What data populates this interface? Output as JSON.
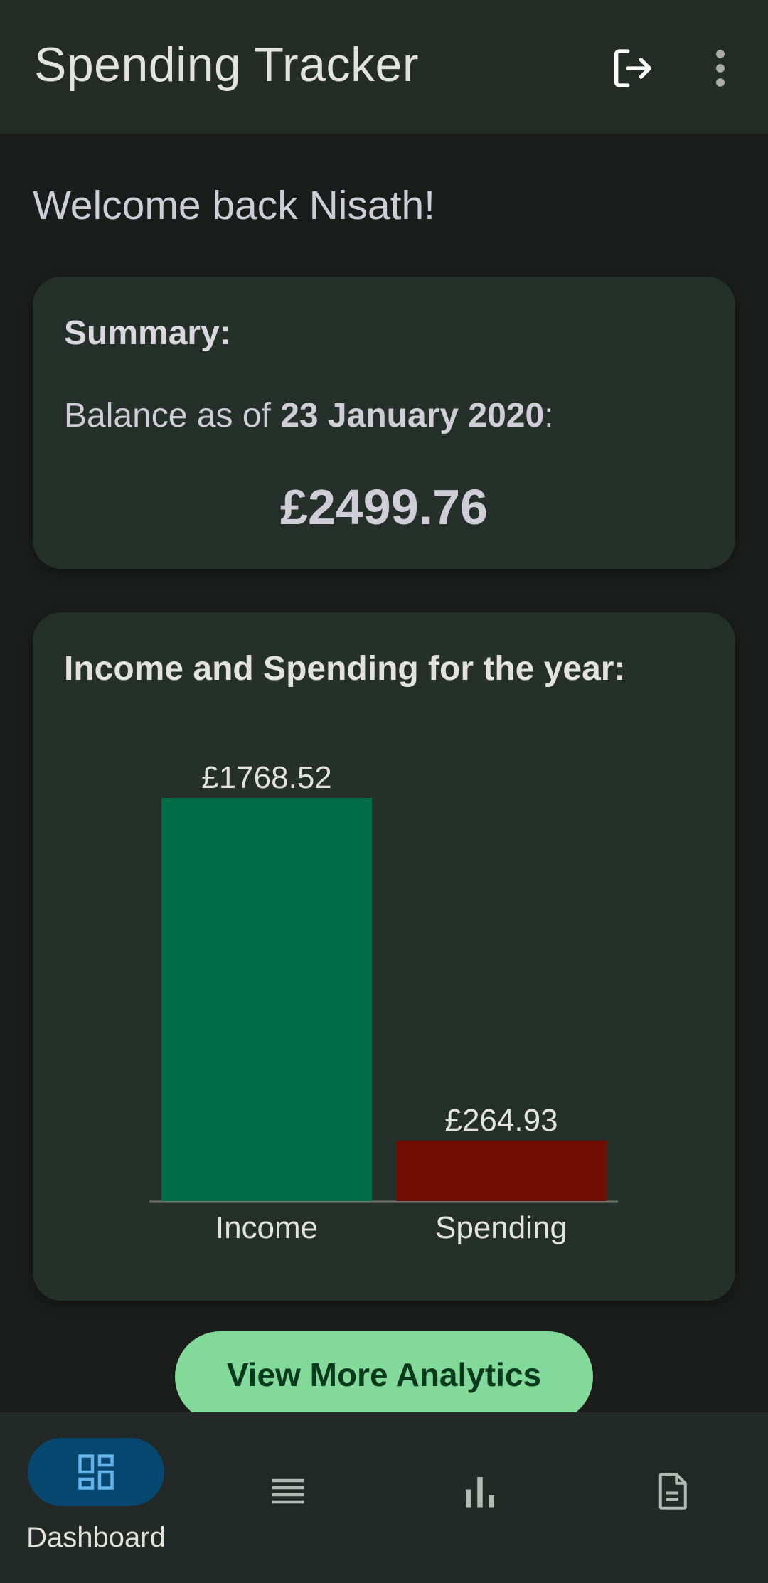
{
  "app_bar": {
    "title": "Spending Tracker",
    "logout_icon": "logout-icon",
    "more_icon": "more-vert-icon"
  },
  "welcome": "Welcome back Nisath!",
  "summary": {
    "heading": "Summary:",
    "balance_prefix": "Balance as of ",
    "balance_date": "23 January 2020",
    "balance_suffix": ":",
    "balance_amount": "£2499.76"
  },
  "chart_card": {
    "heading": "Income and Spending for the year:"
  },
  "chart_data": {
    "type": "bar",
    "categories": [
      "Income",
      "Spending"
    ],
    "values": [
      1768.52,
      264.93
    ],
    "value_labels": [
      "£1768.52",
      "£264.93"
    ],
    "colors": [
      "#006c48",
      "#720d02"
    ],
    "ylim": [
      0,
      1768.52
    ]
  },
  "analytics_button": {
    "label": "View More Analytics"
  },
  "bottom_nav": {
    "items": [
      {
        "label": "Dashboard",
        "icon": "dashboard-icon",
        "active": true
      },
      {
        "label": "",
        "icon": "list-icon",
        "active": false
      },
      {
        "label": "",
        "icon": "bar-chart-icon",
        "active": false
      },
      {
        "label": "",
        "icon": "document-icon",
        "active": false
      }
    ]
  },
  "colors": {
    "background": "#1b1d1c",
    "surface": "#25302a",
    "accent_button": "#83d99a",
    "nav_active": "#08476f",
    "income": "#006c48",
    "spending": "#720d02"
  }
}
